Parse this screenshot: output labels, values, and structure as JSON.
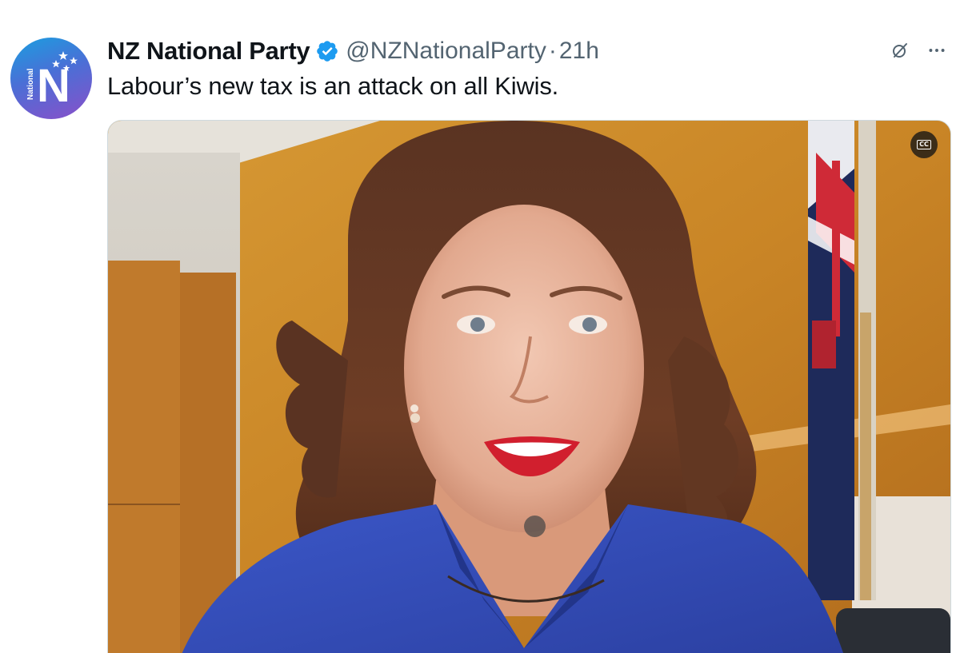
{
  "tweet": {
    "author": {
      "display_name": "NZ National Party",
      "handle": "@NZNationalParty",
      "verified": true,
      "avatar": {
        "logo_letter": "N",
        "logo_word": "National"
      }
    },
    "separator": "·",
    "time": "21h",
    "text": "Labour’s new tax is an attack on all Kiwis.",
    "actions": {
      "grok_icon": "grok-icon",
      "more_icon": "more-icon"
    },
    "media": {
      "type": "video",
      "cc_label": "CC"
    }
  },
  "colors": {
    "text_primary": "#0f1419",
    "text_secondary": "#536471",
    "verified_blue": "#1d9bf0",
    "avatar_gradient_start": "#1a9fe0",
    "avatar_gradient_end": "#8a4fc9"
  }
}
